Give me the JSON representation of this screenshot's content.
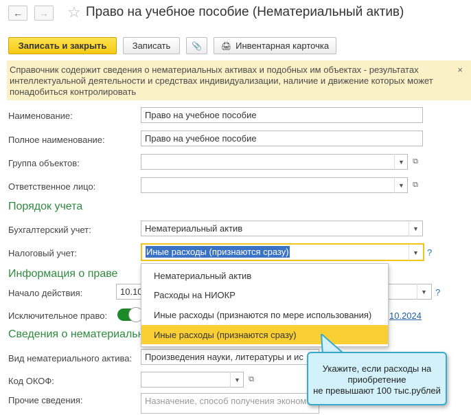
{
  "header": {
    "back_glyph": "←",
    "forward_glyph": "→",
    "favorite_glyph": "☆",
    "title": "Право на учебное пособие (Нематериальный актив)"
  },
  "toolbar": {
    "save_close": "Записать и закрыть",
    "save": "Записать",
    "attach_icon": "📎",
    "print_icon": "🖨",
    "inventory_card": "Инвентарная карточка"
  },
  "info": {
    "text": "Справочник содержит сведения о нематериальных активах и подобных им объектах - результатах интеллектуальной деятельности и средствах индивидуализации, наличие и движение которых может понадобиться контролировать",
    "close": "×"
  },
  "form": {
    "name_label": "Наименование:",
    "name_value": "Право на учебное пособие",
    "fullname_label": "Полное наименование:",
    "fullname_value": "Право на учебное пособие",
    "group_label": "Группа объектов:",
    "responsible_label": "Ответственное лицо:",
    "section_accounting": "Порядок учета",
    "accounting_label": "Бухгалтерский учет:",
    "accounting_value": "Нематериальный актив",
    "tax_label": "Налоговый учет:",
    "tax_value": "Иные расходы (признаются сразу)",
    "qmark": "?",
    "section_rights": "Информация о праве",
    "start_label": "Начало действия:",
    "start_value": "10.10",
    "exclusive_label": "Исключительное право:",
    "exclusive_link": "10.2024",
    "section_intangible": "Сведения о нематериальны",
    "kind_label": "Вид нематериального актива:",
    "kind_value": "Произведения науки, литературы и ис",
    "okof_label": "Код ОКОФ:",
    "other_label": "Прочие сведения:",
    "other_placeholder": "Назначение, способ получения эконом"
  },
  "dropdown": {
    "items": [
      "Нематериальный актив",
      "Расходы на НИОКР",
      "Иные расходы (признаются по мере использования)",
      "Иные расходы (признаются сразу)"
    ],
    "selected_index": 3
  },
  "tooltip": {
    "line1": "Укажите, если расходы на",
    "line2": "приобретение",
    "line3": "не превышают 100 тыс.рублей"
  },
  "colors": {
    "accent_green": "#2e8b3d",
    "primary_button": "#f5c912",
    "selection": "#f9cf33",
    "tooltip_border": "#3aa8cb"
  }
}
